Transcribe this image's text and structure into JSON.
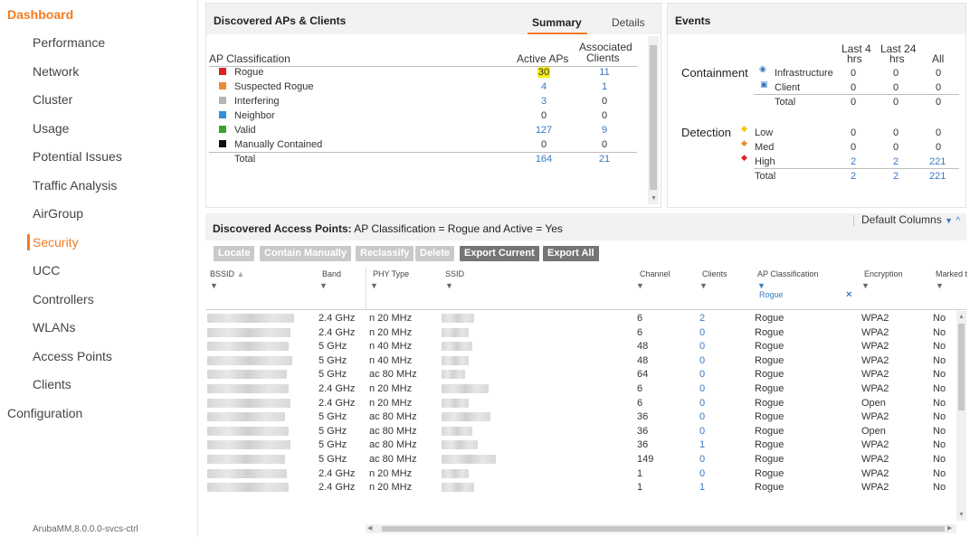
{
  "sidebar": {
    "dashboard": "Dashboard",
    "items": [
      "Performance",
      "Network",
      "Cluster",
      "Usage",
      "Potential Issues",
      "Traffic Analysis",
      "AirGroup",
      "Security",
      "UCC",
      "Controllers",
      "WLANs",
      "Access Points",
      "Clients"
    ],
    "active": "Security",
    "configuration": "Configuration",
    "footer": "ArubaMM,8.0.0.0-svcs-ctrl"
  },
  "colors": {
    "accent": "#f47b20",
    "link": "#3a78c2",
    "highlight": "#f3ef1b"
  },
  "ap_panel": {
    "title": "Discovered APs & Clients",
    "tabs": {
      "summary": "Summary",
      "details": "Details"
    },
    "col_classification": "AP Classification",
    "col_active": "Active APs",
    "col_assoc_1": "Associated",
    "col_assoc_2": "Clients",
    "rows": [
      {
        "label": "Rogue",
        "color": "#e02020",
        "active": "30",
        "clients": "11"
      },
      {
        "label": "Suspected Rogue",
        "color": "#f08a30",
        "active": "4",
        "clients": "1"
      },
      {
        "label": "Interfering",
        "color": "#b5b5b5",
        "active": "3",
        "clients": "0"
      },
      {
        "label": "Neighbor",
        "color": "#2f8fd8",
        "active": "0",
        "clients": "0"
      },
      {
        "label": "Valid",
        "color": "#3aa02e",
        "active": "127",
        "clients": "9"
      },
      {
        "label": "Manually Contained",
        "color": "#111111",
        "active": "0",
        "clients": "0"
      }
    ],
    "total": {
      "label": "Total",
      "active": "164",
      "clients": "21"
    }
  },
  "events": {
    "title": "Events",
    "col_4h_1": "Last 4",
    "col_4h_2": "hrs",
    "col_24h_1": "Last 24",
    "col_24h_2": "hrs",
    "col_all": "All",
    "containment": {
      "label": "Containment",
      "rows": [
        {
          "label": "Infrastructure",
          "h4": "0",
          "h24": "0",
          "all": "0"
        },
        {
          "label": "Client",
          "h4": "0",
          "h24": "0",
          "all": "0"
        }
      ],
      "total": {
        "label": "Total",
        "h4": "0",
        "h24": "0",
        "all": "0"
      }
    },
    "detection": {
      "label": "Detection",
      "rows": [
        {
          "label": "Low",
          "h4": "0",
          "h24": "0",
          "all": "0"
        },
        {
          "label": "Med",
          "h4": "0",
          "h24": "0",
          "all": "0"
        },
        {
          "label": "High",
          "h4": "2",
          "h24": "2",
          "all": "221"
        }
      ],
      "total": {
        "label": "Total",
        "h4": "2",
        "h24": "2",
        "all": "221"
      }
    }
  },
  "access_points": {
    "title_bold": "Discovered Access Points:",
    "title_filter": "AP Classification = Rogue and Active = Yes",
    "default_columns": "Default Columns",
    "buttons": {
      "locate": "Locate",
      "contain": "Contain Manually",
      "reclassify": "Reclassify",
      "delete": "Delete",
      "export_current": "Export Current",
      "export_all": "Export All"
    },
    "columns": {
      "bssid": "BSSID",
      "band": "Band",
      "phy": "PHY Type",
      "ssid": "SSID",
      "channel": "Channel",
      "clients": "Clients",
      "classification": "AP Classification",
      "encryption": "Encryption",
      "marked": "Marked t"
    },
    "filter_value": "Rogue",
    "rows": [
      {
        "band": "2.4 GHz",
        "phy": "n 20 MHz",
        "channel": "6",
        "clients": "2",
        "classification": "Rogue",
        "encryption": "WPA2",
        "marked": "No"
      },
      {
        "band": "2.4 GHz",
        "phy": "n 20 MHz",
        "channel": "6",
        "clients": "0",
        "classification": "Rogue",
        "encryption": "WPA2",
        "marked": "No"
      },
      {
        "band": "5 GHz",
        "phy": "n 40 MHz",
        "channel": "48",
        "clients": "0",
        "classification": "Rogue",
        "encryption": "WPA2",
        "marked": "No"
      },
      {
        "band": "5 GHz",
        "phy": "n 40 MHz",
        "channel": "48",
        "clients": "0",
        "classification": "Rogue",
        "encryption": "WPA2",
        "marked": "No"
      },
      {
        "band": "5 GHz",
        "phy": "ac 80 MHz",
        "channel": "64",
        "clients": "0",
        "classification": "Rogue",
        "encryption": "WPA2",
        "marked": "No"
      },
      {
        "band": "2.4 GHz",
        "phy": "n 20 MHz",
        "channel": "6",
        "clients": "0",
        "classification": "Rogue",
        "encryption": "WPA2",
        "marked": "No"
      },
      {
        "band": "2.4 GHz",
        "phy": "n 20 MHz",
        "channel": "6",
        "clients": "0",
        "classification": "Rogue",
        "encryption": "Open",
        "marked": "No"
      },
      {
        "band": "5 GHz",
        "phy": "ac 80 MHz",
        "channel": "36",
        "clients": "0",
        "classification": "Rogue",
        "encryption": "WPA2",
        "marked": "No"
      },
      {
        "band": "5 GHz",
        "phy": "ac 80 MHz",
        "channel": "36",
        "clients": "0",
        "classification": "Rogue",
        "encryption": "Open",
        "marked": "No"
      },
      {
        "band": "5 GHz",
        "phy": "ac 80 MHz",
        "channel": "36",
        "clients": "1",
        "classification": "Rogue",
        "encryption": "WPA2",
        "marked": "No"
      },
      {
        "band": "5 GHz",
        "phy": "ac 80 MHz",
        "channel": "149",
        "clients": "0",
        "classification": "Rogue",
        "encryption": "WPA2",
        "marked": "No"
      },
      {
        "band": "2.4 GHz",
        "phy": "n 20 MHz",
        "channel": "1",
        "clients": "0",
        "classification": "Rogue",
        "encryption": "WPA2",
        "marked": "No"
      },
      {
        "band": "2.4 GHz",
        "phy": "n 20 MHz",
        "channel": "1",
        "clients": "1",
        "classification": "Rogue",
        "encryption": "WPA2",
        "marked": "No"
      }
    ]
  }
}
